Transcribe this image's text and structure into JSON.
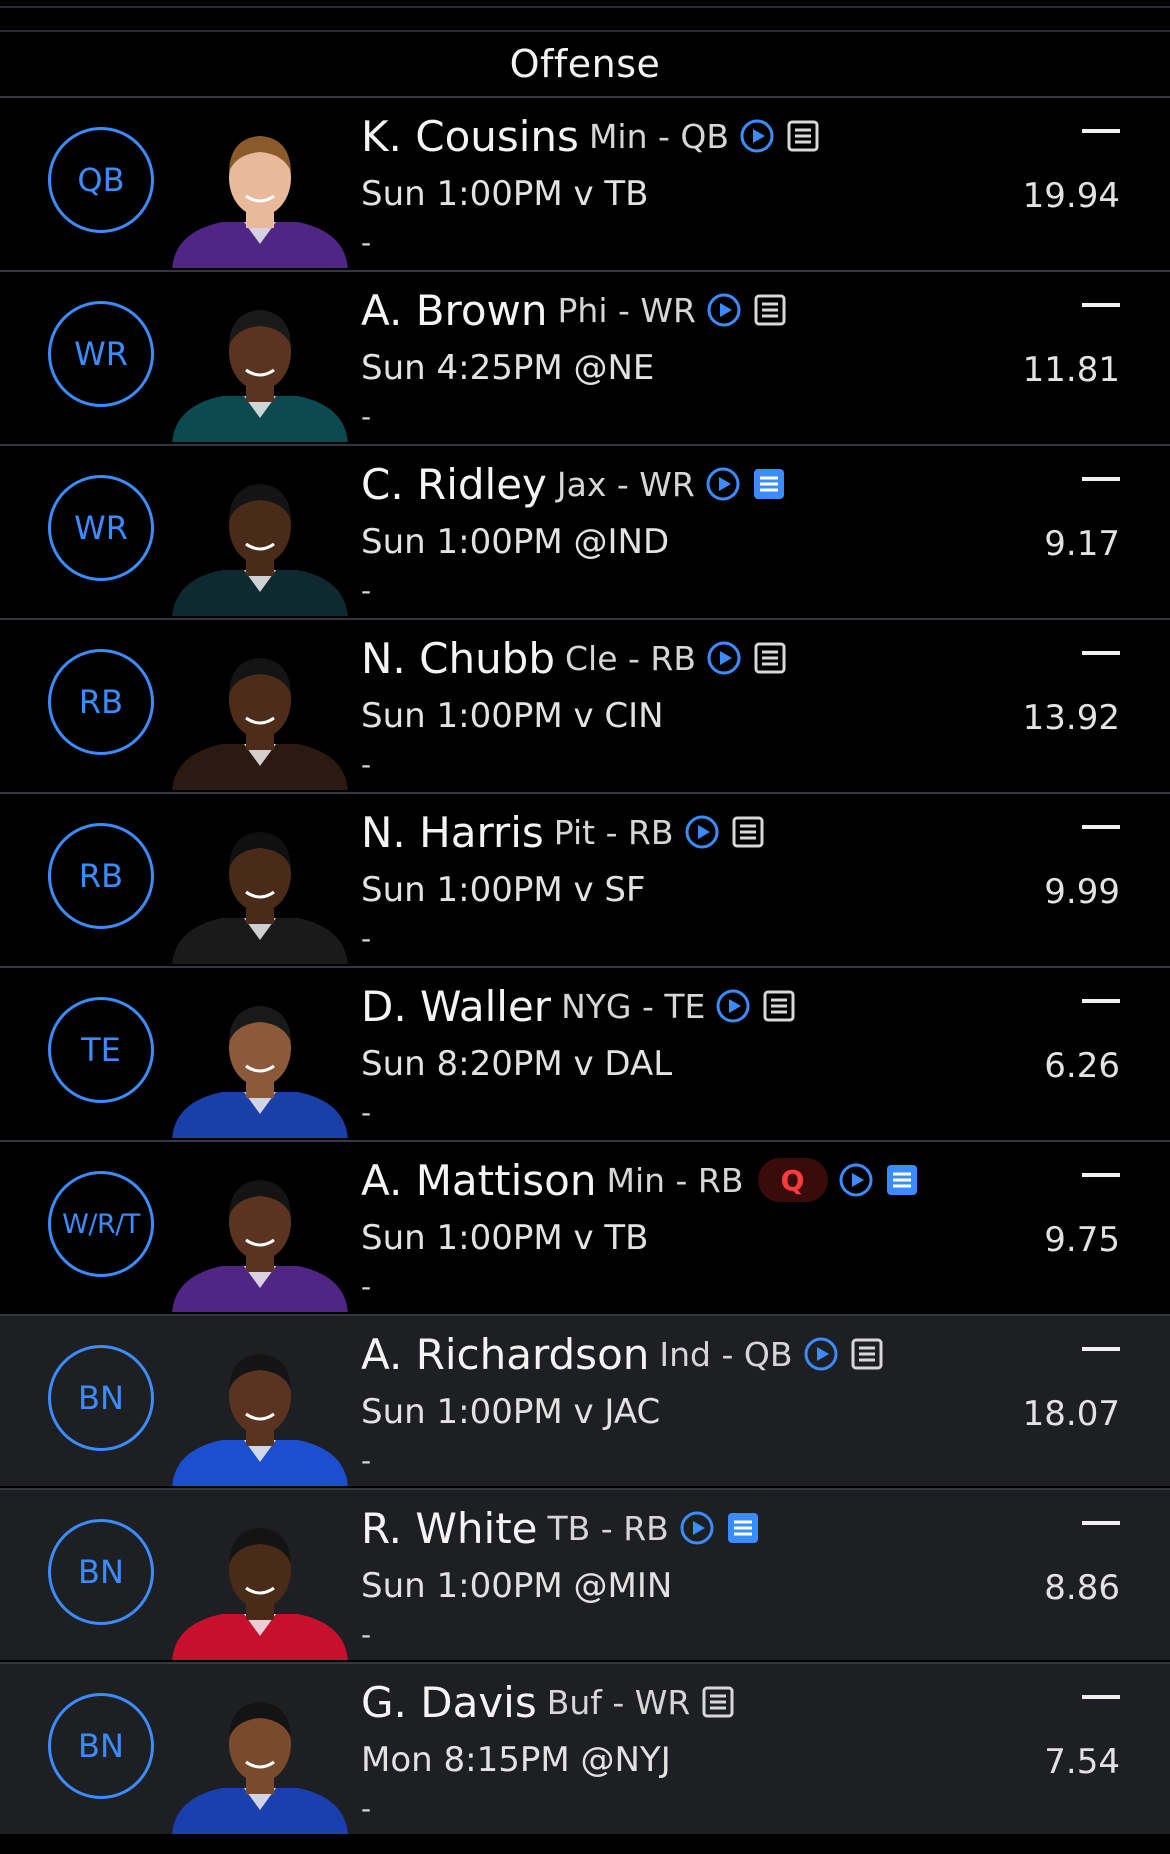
{
  "section": {
    "title": "Offense"
  },
  "colors": {
    "accent": "#3a8cff",
    "starter_bg": "#000000",
    "bench_bg": "#1d1f23",
    "questionable": "#ff3b3b"
  },
  "players": [
    {
      "slot": "QB",
      "name": "K. Cousins",
      "team_pos": "Min - QB",
      "game": "Sun 1:00PM v TB",
      "detail": "-",
      "projection": "19.94",
      "has_video": true,
      "note_active": false,
      "status": "",
      "bench": false,
      "jersey": "#4f2683",
      "skin": "#e8b99a",
      "hair": "#8a5a2b"
    },
    {
      "slot": "WR",
      "name": "A. Brown",
      "team_pos": "Phi - WR",
      "game": "Sun 4:25PM @NE",
      "detail": "-",
      "projection": "11.81",
      "has_video": true,
      "note_active": false,
      "status": "",
      "bench": false,
      "jersey": "#0c4a50",
      "skin": "#5a3420",
      "hair": "#1a1a1a"
    },
    {
      "slot": "WR",
      "name": "C. Ridley",
      "team_pos": "Jax - WR",
      "game": "Sun 1:00PM @IND",
      "detail": "-",
      "projection": "9.17",
      "has_video": true,
      "note_active": true,
      "status": "",
      "bench": false,
      "jersey": "#0e2a30",
      "skin": "#4a2a18",
      "hair": "#141414"
    },
    {
      "slot": "RB",
      "name": "N. Chubb",
      "team_pos": "Cle - RB",
      "game": "Sun 1:00PM v CIN",
      "detail": "-",
      "projection": "13.92",
      "has_video": true,
      "note_active": false,
      "status": "",
      "bench": false,
      "jersey": "#2b1a12",
      "skin": "#4e2c1a",
      "hair": "#141414"
    },
    {
      "slot": "RB",
      "name": "N. Harris",
      "team_pos": "Pit - RB",
      "game": "Sun 1:00PM v SF",
      "detail": "-",
      "projection": "9.99",
      "has_video": true,
      "note_active": false,
      "status": "",
      "bench": false,
      "jersey": "#1a1a1a",
      "skin": "#4a2a18",
      "hair": "#101010"
    },
    {
      "slot": "TE",
      "name": "D. Waller",
      "team_pos": "NYG - TE",
      "game": "Sun 8:20PM v DAL",
      "detail": "-",
      "projection": "6.26",
      "has_video": true,
      "note_active": false,
      "status": "",
      "bench": false,
      "jersey": "#1b3fa8",
      "skin": "#8a5a3a",
      "hair": "#1a1a1a"
    },
    {
      "slot": "W/R/T",
      "name": "A. Mattison",
      "team_pos": "Min - RB",
      "game": "Sun 1:00PM v TB",
      "detail": "-",
      "projection": "9.75",
      "has_video": true,
      "note_active": true,
      "status": "Q",
      "bench": false,
      "jersey": "#4f2683",
      "skin": "#5a3420",
      "hair": "#141414"
    },
    {
      "slot": "BN",
      "name": "A. Richardson",
      "team_pos": "Ind - QB",
      "game": "Sun 1:00PM v JAC",
      "detail": "-",
      "projection": "18.07",
      "has_video": true,
      "note_active": false,
      "status": "",
      "bench": true,
      "jersey": "#1c4fd0",
      "skin": "#5a3420",
      "hair": "#141414"
    },
    {
      "slot": "BN",
      "name": "R. White",
      "team_pos": "TB - RB",
      "game": "Sun 1:00PM @MIN",
      "detail": "-",
      "projection": "8.86",
      "has_video": true,
      "note_active": true,
      "status": "",
      "bench": true,
      "jersey": "#c8102e",
      "skin": "#4a2a18",
      "hair": "#141414"
    },
    {
      "slot": "BN",
      "name": "G. Davis",
      "team_pos": "Buf - WR",
      "game": "Mon 8:15PM @NYJ",
      "detail": "-",
      "projection": "7.54",
      "has_video": false,
      "note_active": false,
      "status": "",
      "bench": true,
      "jersey": "#1c3fb0",
      "skin": "#7a4a2c",
      "hair": "#141414"
    }
  ]
}
